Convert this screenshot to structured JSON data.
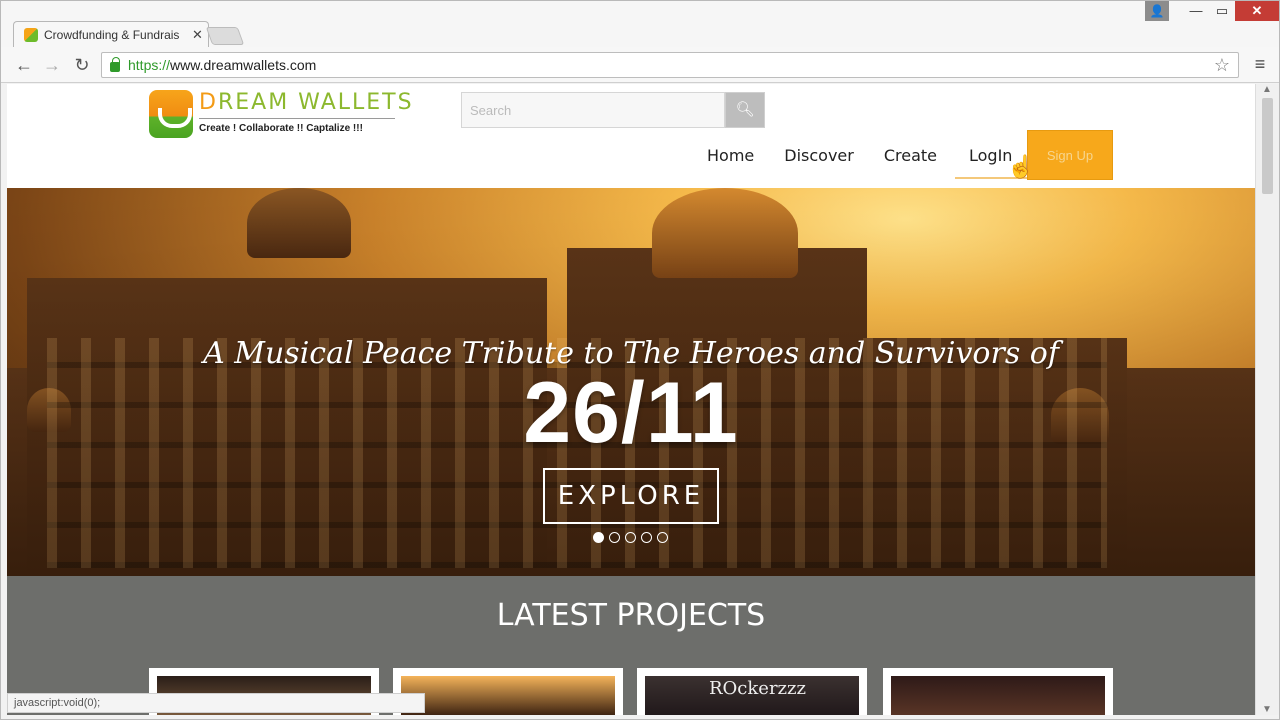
{
  "browser": {
    "tab_title": "Crowdfunding & Fundrais",
    "tab_close": "✕",
    "url_scheme": "https://",
    "url_host": "www.dreamwallets.com",
    "status_text": "javascript:void(0);"
  },
  "site": {
    "logo_name_first": "D",
    "logo_name_rest": "REAM WALLETS",
    "tagline": "Create ! Collaborate !! Captalize !!!",
    "search_placeholder": "Search",
    "nav": [
      "Home",
      "Discover",
      "Create"
    ],
    "login_label": "LogIn",
    "signup_label": "Sign Up"
  },
  "hero": {
    "script_text": "A Musical Peace Tribute to The Heroes and Survivors of",
    "big_text": "26/11",
    "cta_label": "EXPLORE",
    "slides": 5,
    "active_slide": 1
  },
  "latest": {
    "title": "LATEST PROJECTS",
    "card3_label": "ROckerzzz"
  },
  "colors": {
    "accent": "#f7a81b",
    "brand_green": "#8cb82e",
    "section_gray": "#6d6e6b"
  }
}
